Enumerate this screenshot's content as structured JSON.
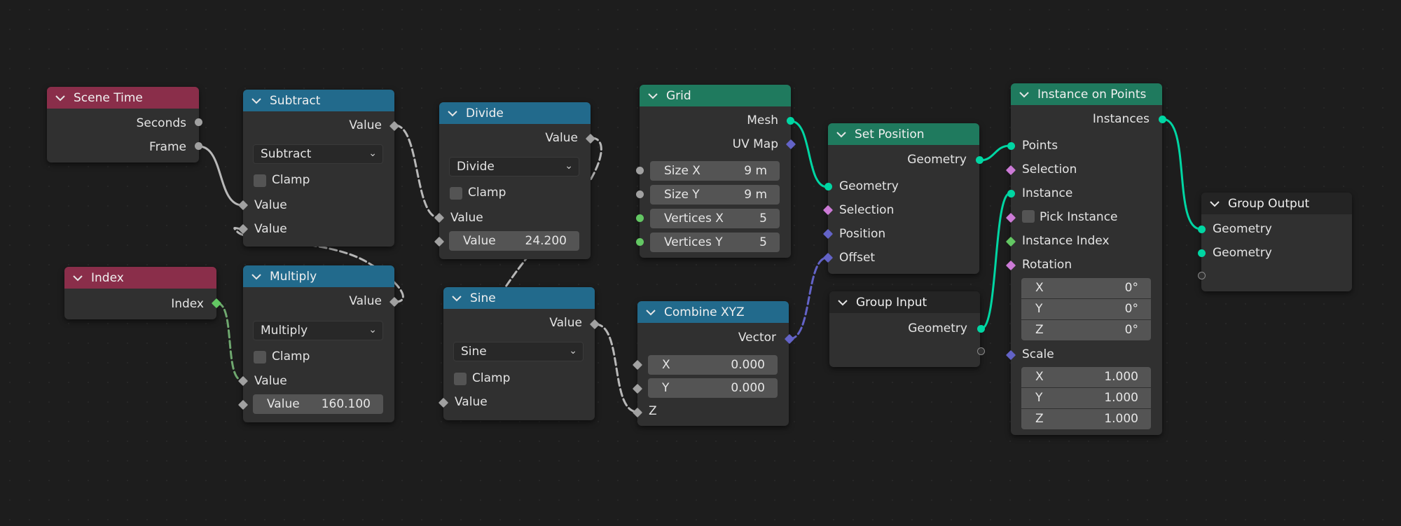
{
  "nodes": {
    "scene_time": {
      "title": "Scene Time",
      "out_seconds": "Seconds",
      "out_frame": "Frame"
    },
    "index": {
      "title": "Index",
      "out_index": "Index"
    },
    "subtract": {
      "title": "Subtract",
      "out_value": "Value",
      "operation": "Subtract",
      "clamp": "Clamp",
      "in_value1": "Value",
      "in_value2": "Value"
    },
    "multiply": {
      "title": "Multiply",
      "out_value": "Value",
      "operation": "Multiply",
      "clamp": "Clamp",
      "in_value1": "Value",
      "in_value2_label": "Value",
      "in_value2": "160.100"
    },
    "divide": {
      "title": "Divide",
      "out_value": "Value",
      "operation": "Divide",
      "clamp": "Clamp",
      "in_value1": "Value",
      "in_value2_label": "Value",
      "in_value2": "24.200"
    },
    "sine": {
      "title": "Sine",
      "out_value": "Value",
      "operation": "Sine",
      "clamp": "Clamp",
      "in_value": "Value"
    },
    "grid": {
      "title": "Grid",
      "out_mesh": "Mesh",
      "out_uvmap": "UV Map",
      "size_x_label": "Size X",
      "size_x": "9 m",
      "size_y_label": "Size Y",
      "size_y": "9 m",
      "verts_x_label": "Vertices X",
      "verts_x": "5",
      "verts_y_label": "Vertices Y",
      "verts_y": "5"
    },
    "combine_xyz": {
      "title": "Combine XYZ",
      "out_vector": "Vector",
      "x_label": "X",
      "x": "0.000",
      "y_label": "Y",
      "y": "0.000",
      "z_label": "Z"
    },
    "set_position": {
      "title": "Set Position",
      "out_geometry": "Geometry",
      "in_geometry": "Geometry",
      "in_selection": "Selection",
      "in_position": "Position",
      "in_offset": "Offset"
    },
    "group_input": {
      "title": "Group Input",
      "out_geometry": "Geometry"
    },
    "instance_on_points": {
      "title": "Instance on Points",
      "out_instances": "Instances",
      "in_points": "Points",
      "in_selection": "Selection",
      "in_instance": "Instance",
      "pick_instance": "Pick Instance",
      "in_instance_index": "Instance Index",
      "in_rotation": "Rotation",
      "rot_x_label": "X",
      "rot_x": "0°",
      "rot_y_label": "Y",
      "rot_y": "0°",
      "rot_z_label": "Z",
      "rot_z": "0°",
      "in_scale": "Scale",
      "scale_x_label": "X",
      "scale_x": "1.000",
      "scale_y_label": "Y",
      "scale_y": "1.000",
      "scale_z_label": "Z",
      "scale_z": "1.000"
    },
    "group_output": {
      "title": "Group Output",
      "in_geometry1": "Geometry",
      "in_geometry2": "Geometry"
    }
  },
  "colors": {
    "input_header": "#8a2e4a",
    "math_header": "#226a8c",
    "geometry_header": "#1f7a5e",
    "group_header": "#242424",
    "geometry_socket": "#00d6a3",
    "vector_socket": "#6363c7",
    "float_socket": "#a1a1a1"
  },
  "icons": {
    "collapse": "chevron-down-icon",
    "dropdown": "chevron-down-icon"
  }
}
